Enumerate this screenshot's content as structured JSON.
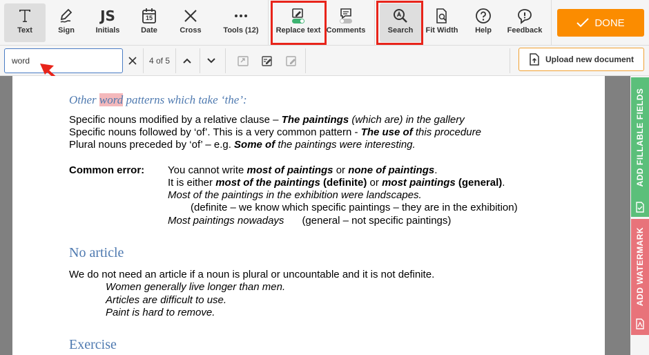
{
  "toolbar": {
    "tools": [
      {
        "label": "Text",
        "icon": "text-icon"
      },
      {
        "label": "Sign",
        "icon": "sign-icon"
      },
      {
        "label": "Initials",
        "icon": "initials-icon"
      },
      {
        "label": "Date",
        "icon": "date-icon"
      },
      {
        "label": "Cross",
        "icon": "cross-icon"
      },
      {
        "label": "Tools (12)",
        "icon": "more-icon"
      },
      {
        "label": "Replace text",
        "icon": "replace-text-icon"
      },
      {
        "label": "Comments",
        "icon": "comments-icon"
      },
      {
        "label": "Search",
        "icon": "search-icon"
      },
      {
        "label": "Fit Width",
        "icon": "fit-width-icon"
      },
      {
        "label": "Help",
        "icon": "help-icon"
      },
      {
        "label": "Feedback",
        "icon": "feedback-icon"
      }
    ],
    "initials_glyph": "JS",
    "date_glyph": "15",
    "done_label": "DONE",
    "accent": "#fb8c00",
    "highlight_box_color": "#e8241a"
  },
  "searchbar": {
    "query": "word",
    "match_count": "4 of 5",
    "upload_label": "Upload new document"
  },
  "document": {
    "subheading_pre": "Other ",
    "subheading_hit": "word",
    "subheading_post": " patterns which take ‘the’:",
    "l1a": "Specific nouns modified by a relative clause – ",
    "l1b": "The paintings",
    "l1c": " (which are) in the gallery",
    "l2a": "Specific nouns followed by ‘of’. This is a very common pattern - ",
    "l2b": "The use of",
    "l2c": " this procedure",
    "l3a": "Plural nouns preceded by ‘of’ – e.g. ",
    "l3b": "Some of",
    "l3c": " the paintings were interesting.",
    "common_error_label": "Common error:",
    "ce1a": "You cannot write ",
    "ce1b": "most of paintings",
    "ce1c": " or ",
    "ce1d": "none of paintings",
    "ce1e": ".",
    "ce2a": "It is either ",
    "ce2b": "most of the paintings",
    "ce2c": " (definite)",
    "ce2d": " or ",
    "ce2e": "most paintings",
    "ce2f": " (general)",
    "ce2g": ".",
    "ce3": "Most of the paintings in the exhibition were landscapes.",
    "ce4": "(definite – we know which specific paintings – they are in the exhibition)",
    "ce5a": "Most paintings nowadays",
    "ce5b": "(general – not specific paintings)",
    "heading_no_article": "No article",
    "na1": "We do not need an article if a noun is plural or uncountable and it is not definite.",
    "na2": "Women generally live longer than men.",
    "na3": "Articles are difficult to use.",
    "na4": "Paint is hard to remove.",
    "heading_exercise": "Exercise"
  },
  "side_tabs": {
    "fillable": {
      "label": "ADD FILLABLE FIELDS",
      "color": "#5bbf7a"
    },
    "watermark": {
      "label": "ADD WATERMARK",
      "color": "#e8737a"
    }
  }
}
